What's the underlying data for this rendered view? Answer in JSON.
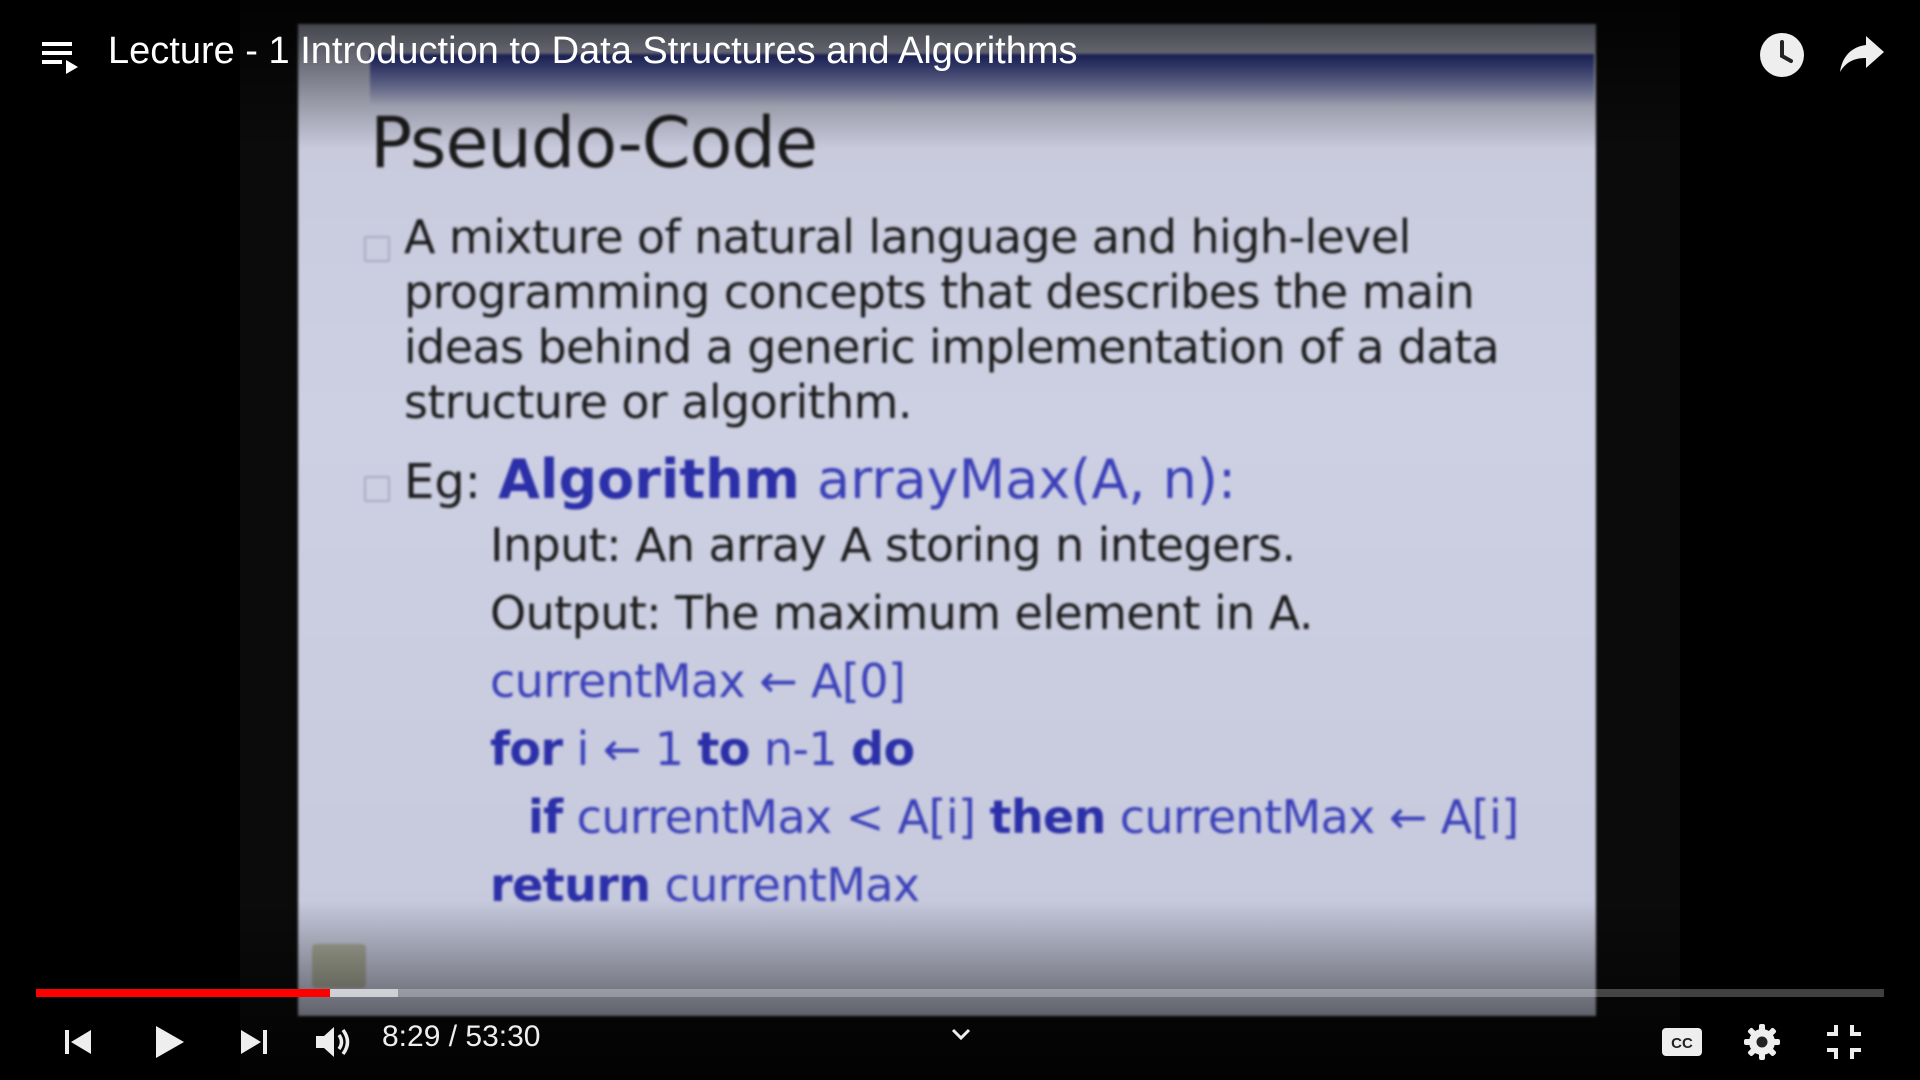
{
  "header": {
    "title": "Lecture - 1 Introduction to Data Structures and Algorithms",
    "icons": [
      "playlist-icon",
      "clock-icon",
      "share-icon"
    ]
  },
  "slide": {
    "title": "Pseudo-Code",
    "para1": "A mixture of natural language and high-level programming concepts that describes the main ideas behind a generic implementation of a data structure or algorithm.",
    "eg_prefix": "Eg:",
    "eg_algo": "Algorithm",
    "eg_sig": "arrayMax(A, n):",
    "input_label": "Input:",
    "input_text": "An array A storing n integers.",
    "output_label": "Output:",
    "output_text": "The maximum element in A.",
    "line1": "currentMax ← A[0]",
    "line2_kw1": "for",
    "line2_mid": "i ← 1",
    "line2_kw2": "to",
    "line2_mid2": "n-1",
    "line2_kw3": "do",
    "line3_kw1": "if",
    "line3_mid": "currentMax < A[i]",
    "line3_kw2": "then",
    "line3_end": "currentMax ← A[i]",
    "line4_kw": "return",
    "line4_end": "currentMax"
  },
  "player": {
    "current_time": "8:29",
    "separator": " / ",
    "duration": "53:30",
    "played_fraction": 0.159,
    "buffered_fraction": 0.196,
    "colors": {
      "played": "#ff0000",
      "text": "#ffffff"
    },
    "controls": [
      "previous-icon",
      "play-icon",
      "next-icon",
      "volume-icon",
      "chevron-down-icon",
      "captions-icon",
      "settings-icon",
      "exit-fullscreen-icon"
    ],
    "captions_label": "CC"
  }
}
